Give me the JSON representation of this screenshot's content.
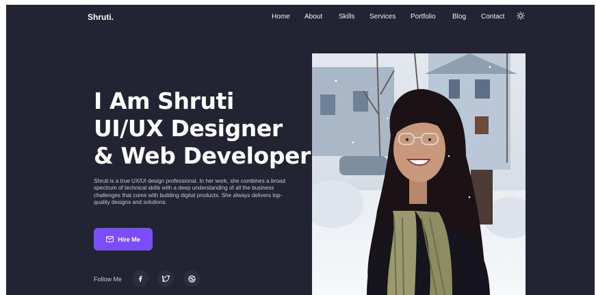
{
  "brand": {
    "logo": "Shruti."
  },
  "nav": {
    "items": [
      {
        "label": "Home"
      },
      {
        "label": "About"
      },
      {
        "label": "Skills"
      },
      {
        "label": "Services"
      },
      {
        "label": "Portfolio"
      },
      {
        "label": "Blog"
      },
      {
        "label": "Contact"
      }
    ],
    "theme_toggle_icon": "sun-icon"
  },
  "hero": {
    "heading_lines": [
      "I Am Shruti",
      "UI/UX Designer",
      "& Web Developer"
    ],
    "description": "Shruti is a true UX/UI design professional. In her work, she combines a broad spectrum of technical skills with a deep understanding of all the business challenges that come with building digital products. She always delivers top-quality designs and solutions.",
    "cta_label": "Hire Me",
    "cta_icon": "mail-icon",
    "follow_label": "Follow Me",
    "social_icons": [
      "facebook-icon",
      "twitter-icon",
      "dribbble-icon"
    ]
  },
  "colors": {
    "background": "#222433",
    "accent": "#7c4dff",
    "text": "#ffffff"
  }
}
